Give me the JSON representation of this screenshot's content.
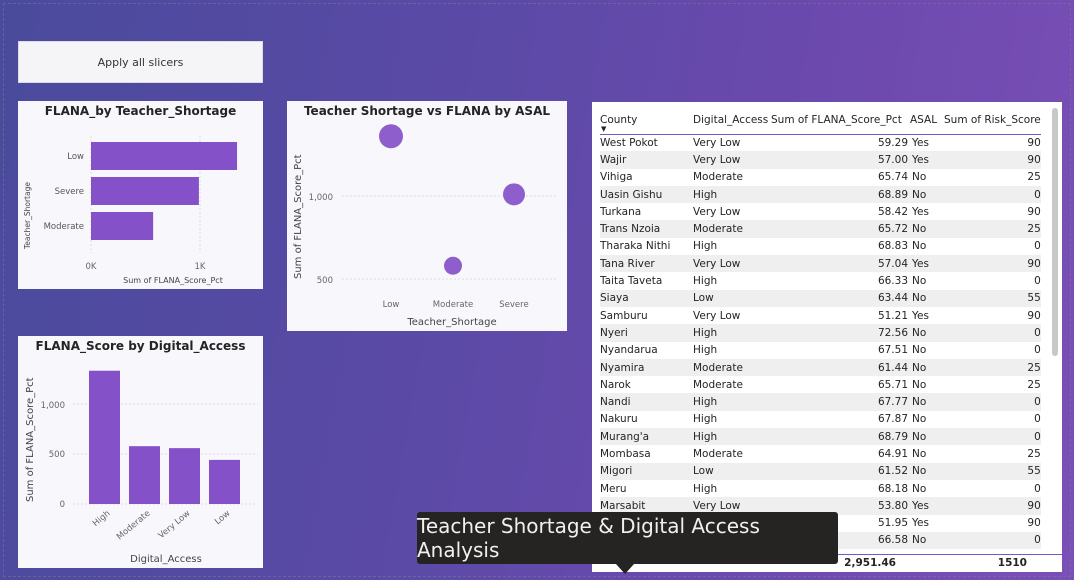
{
  "apply_button": {
    "label": "Apply all slicers"
  },
  "bar_chart": {
    "title": "FLANA_by Teacher_Shortage",
    "ylabel": "Teacher_Shortage",
    "xlabel": "Sum of FLANA_Score_Pct",
    "x_ticks": [
      "0K",
      "1K"
    ]
  },
  "scatter_chart": {
    "title": "Teacher Shortage vs FLANA by ASAL",
    "ylabel": "Sum of FLANA_Score_Pct",
    "xlabel": "Teacher_Shortage",
    "y_ticks": [
      "1,000",
      "500"
    ]
  },
  "column_chart": {
    "title": "FLANA_Score by Digital_Access",
    "ylabel": "Sum of FLANA_Score_Pct",
    "xlabel": "Digital_Access",
    "y_ticks": [
      "1,000",
      "500",
      "0"
    ]
  },
  "chart_data": [
    {
      "type": "bar",
      "title": "FLANA_by Teacher_Shortage",
      "categories": [
        "Low",
        "Severe",
        "Moderate"
      ],
      "values": [
        1340,
        990,
        570
      ],
      "xlabel": "Sum of FLANA_Score_Pct",
      "ylabel": "Teacher_Shortage",
      "xlim": [
        0,
        1450
      ]
    },
    {
      "type": "scatter",
      "title": "Teacher Shortage vs FLANA by ASAL",
      "x": [
        "Low",
        "Moderate",
        "Severe"
      ],
      "points": [
        {
          "x": "Low",
          "y": 1360,
          "size": 3
        },
        {
          "x": "Severe",
          "y": 1010,
          "size": 2
        },
        {
          "x": "Moderate",
          "y": 580,
          "size": 1
        }
      ],
      "xlabel": "Teacher_Shortage",
      "ylabel": "Sum of FLANA_Score_Pct",
      "ylim": [
        400,
        1360
      ]
    },
    {
      "type": "bar",
      "title": "FLANA_Score by Digital_Access",
      "categories": [
        "High",
        "Moderate",
        "Very Low",
        "Low"
      ],
      "values": [
        1360,
        590,
        570,
        450
      ],
      "xlabel": "Digital_Access",
      "ylabel": "Sum of FLANA_Score_Pct",
      "ylim": [
        0,
        1450
      ]
    }
  ],
  "table": {
    "headers": [
      "County",
      "Digital_Access",
      "Sum of FLANA_Score_Pct",
      "ASAL",
      "Sum of Risk_Score"
    ],
    "rows": [
      [
        "West Pokot",
        "Very Low",
        "59.29",
        "Yes",
        "90"
      ],
      [
        "Wajir",
        "Very Low",
        "57.00",
        "Yes",
        "90"
      ],
      [
        "Vihiga",
        "Moderate",
        "65.74",
        "No",
        "25"
      ],
      [
        "Uasin Gishu",
        "High",
        "68.89",
        "No",
        "0"
      ],
      [
        "Turkana",
        "Very Low",
        "58.42",
        "Yes",
        "90"
      ],
      [
        "Trans Nzoia",
        "Moderate",
        "65.72",
        "No",
        "25"
      ],
      [
        "Tharaka Nithi",
        "High",
        "68.83",
        "No",
        "0"
      ],
      [
        "Tana River",
        "Very Low",
        "57.04",
        "Yes",
        "90"
      ],
      [
        "Taita Taveta",
        "High",
        "66.33",
        "No",
        "0"
      ],
      [
        "Siaya",
        "Low",
        "63.44",
        "No",
        "55"
      ],
      [
        "Samburu",
        "Very Low",
        "51.21",
        "Yes",
        "90"
      ],
      [
        "Nyeri",
        "High",
        "72.56",
        "No",
        "0"
      ],
      [
        "Nyandarua",
        "High",
        "67.51",
        "No",
        "0"
      ],
      [
        "Nyamira",
        "Moderate",
        "61.44",
        "No",
        "25"
      ],
      [
        "Narok",
        "Moderate",
        "65.71",
        "No",
        "25"
      ],
      [
        "Nandi",
        "High",
        "67.77",
        "No",
        "0"
      ],
      [
        "Nakuru",
        "High",
        "67.87",
        "No",
        "0"
      ],
      [
        "Murang'a",
        "High",
        "68.79",
        "No",
        "0"
      ],
      [
        "Mombasa",
        "Moderate",
        "64.91",
        "No",
        "25"
      ],
      [
        "Migori",
        "Low",
        "61.52",
        "No",
        "55"
      ],
      [
        "Meru",
        "High",
        "68.18",
        "No",
        "0"
      ],
      [
        "Marsabit",
        "Very Low",
        "53.80",
        "Yes",
        "90"
      ],
      [
        "",
        "",
        "51.95",
        "Yes",
        "90"
      ],
      [
        "",
        "",
        "66.58",
        "No",
        "0"
      ]
    ],
    "total": {
      "flana": "2,951.46",
      "risk": "1510"
    }
  },
  "tooltip": {
    "text": "Teacher Shortage & Digital Access Analysis"
  },
  "colors": {
    "bar": "#8451c8",
    "accent": "#6b5bc8"
  }
}
